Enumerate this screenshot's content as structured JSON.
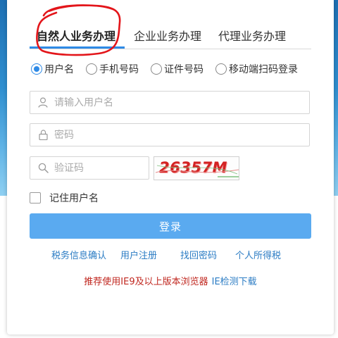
{
  "tabs": [
    {
      "label": "自然人业务办理",
      "active": true
    },
    {
      "label": "企业业务办理",
      "active": false
    },
    {
      "label": "代理业务办理",
      "active": false
    }
  ],
  "login_types": [
    {
      "label": "用户名",
      "checked": true
    },
    {
      "label": "手机号码",
      "checked": false
    },
    {
      "label": "证件号码",
      "checked": false
    },
    {
      "label": "移动端扫码登录",
      "checked": false
    }
  ],
  "fields": {
    "username": {
      "placeholder": "请输入用户名",
      "value": "",
      "icon": "user-icon"
    },
    "password": {
      "placeholder": "密码",
      "value": "",
      "icon": "lock-icon"
    },
    "captcha": {
      "placeholder": "验证码",
      "value": "",
      "icon": "search-icon"
    }
  },
  "captcha_image": {
    "text": "26357M"
  },
  "remember": {
    "label": "记住用户名",
    "checked": false
  },
  "login_button": {
    "label": "登录"
  },
  "links": [
    "税务信息确认",
    "用户注册",
    "找回密码",
    "个人所得税"
  ],
  "notice": {
    "text": "推荐使用IE9及以上版本浏览器",
    "link": "IE检测下载"
  },
  "colors": {
    "accent": "#2e8ae6",
    "button": "#5aaaf0",
    "link": "#2b7cc4",
    "notice_red": "#c0271f",
    "captcha_red": "#d32222",
    "annotation_red": "#e3151a"
  }
}
